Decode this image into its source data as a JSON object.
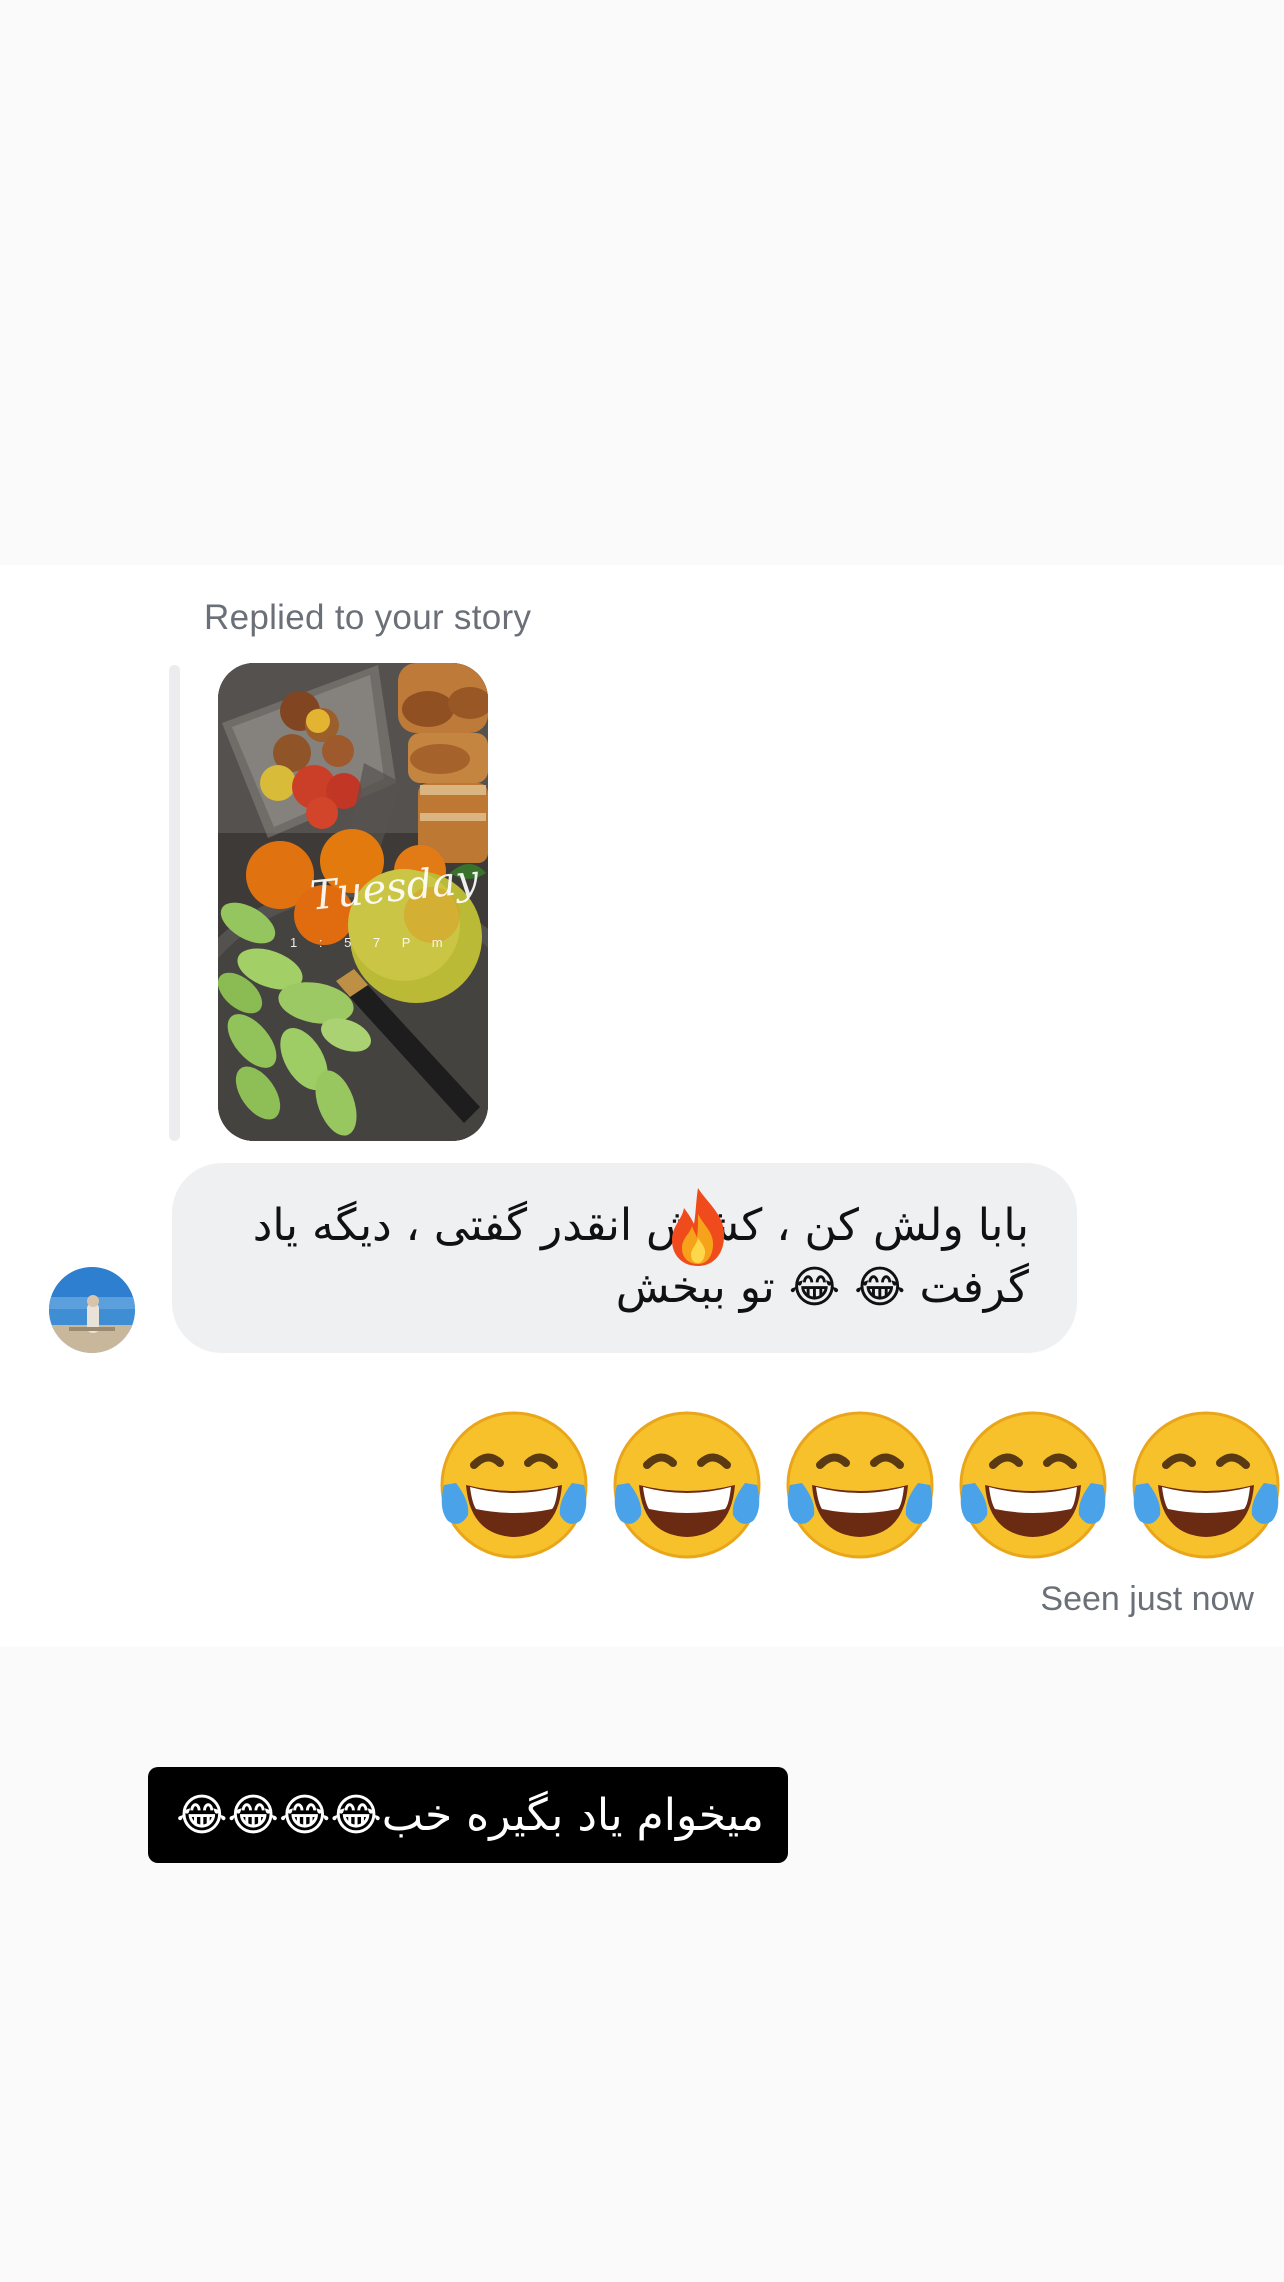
{
  "story_reply": {
    "label": "Replied to your story",
    "story_text": {
      "day": "Tuesday",
      "time": "1 : 5 7 P m"
    }
  },
  "message": {
    "text": "بابا ولش کن ، کشش انقدر گفتی ، دیگه یاد\nگرفت 😂 😂 تو ببخش"
  },
  "big_emoji_reply": {
    "emoji": "😂",
    "count": 5
  },
  "status": {
    "seen": "Seen just now"
  },
  "caption": {
    "text": "میخوام یاد بگیره خب😂😂😂😂"
  },
  "colors": {
    "bubble": "#eff0f2",
    "muted_text": "#6b7078",
    "caption_bg": "#000000",
    "background": "#fafafa"
  },
  "icons": {
    "fire": "fire-icon",
    "laugh": "face-with-tears-of-joy-icon"
  }
}
